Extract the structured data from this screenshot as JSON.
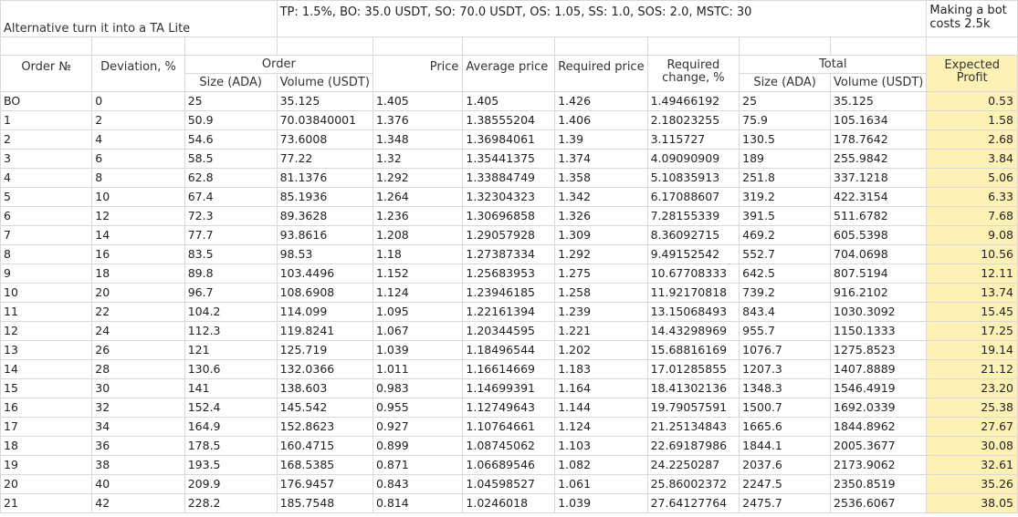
{
  "top": {
    "left_note": "Alternative turn it into a TA Lite",
    "params_note": "TP: 1.5%, BO: 35.0 USDT, SO: 70.0 USDT, OS: 1.05, SS: 1.0, SOS: 2.0, MSTC: 30",
    "bot_note": "Making a bot costs 2.5k"
  },
  "headers": {
    "order_no": "Order №",
    "deviation": "Deviation, %",
    "order": "Order",
    "price": "Price",
    "average_price": "Average price",
    "required_price": "Required price",
    "required_change": "Required change, %",
    "total": "Total",
    "expected_profit": "Expected Profit",
    "size_ada": "Size (ADA)",
    "volume_usdt": "Volume (USDT)",
    "total_size_ada": "Size (ADA)",
    "total_volume_usdt": "Volume (USDT)"
  },
  "rows": [
    [
      "BO",
      "0",
      "25",
      "35.125",
      "1.405",
      "1.405",
      "1.426",
      "1.49466192",
      "25",
      "35.125",
      "0.53"
    ],
    [
      "1",
      "2",
      "50.9",
      "70.03840001",
      "1.376",
      "1.38555204",
      "1.406",
      "2.18023255",
      "75.9",
      "105.1634",
      "1.58"
    ],
    [
      "2",
      "4",
      "54.6",
      "73.6008",
      "1.348",
      "1.36984061",
      "1.39",
      "3.115727",
      "130.5",
      "178.7642",
      "2.68"
    ],
    [
      "3",
      "6",
      "58.5",
      "77.22",
      "1.32",
      "1.35441375",
      "1.374",
      "4.09090909",
      "189",
      "255.9842",
      "3.84"
    ],
    [
      "4",
      "8",
      "62.8",
      "81.1376",
      "1.292",
      "1.33884749",
      "1.358",
      "5.10835913",
      "251.8",
      "337.1218",
      "5.06"
    ],
    [
      "5",
      "10",
      "67.4",
      "85.1936",
      "1.264",
      "1.32304323",
      "1.342",
      "6.17088607",
      "319.2",
      "422.3154",
      "6.33"
    ],
    [
      "6",
      "12",
      "72.3",
      "89.3628",
      "1.236",
      "1.30696858",
      "1.326",
      "7.28155339",
      "391.5",
      "511.6782",
      "7.68"
    ],
    [
      "7",
      "14",
      "77.7",
      "93.8616",
      "1.208",
      "1.29057928",
      "1.309",
      "8.36092715",
      "469.2",
      "605.5398",
      "9.08"
    ],
    [
      "8",
      "16",
      "83.5",
      "98.53",
      "1.18",
      "1.27387334",
      "1.292",
      "9.49152542",
      "552.7",
      "704.0698",
      "10.56"
    ],
    [
      "9",
      "18",
      "89.8",
      "103.4496",
      "1.152",
      "1.25683953",
      "1.275",
      "10.67708333",
      "642.5",
      "807.5194",
      "12.11"
    ],
    [
      "10",
      "20",
      "96.7",
      "108.6908",
      "1.124",
      "1.23946185",
      "1.258",
      "11.92170818",
      "739.2",
      "916.2102",
      "13.74"
    ],
    [
      "11",
      "22",
      "104.2",
      "114.099",
      "1.095",
      "1.22161394",
      "1.239",
      "13.15068493",
      "843.4",
      "1030.3092",
      "15.45"
    ],
    [
      "12",
      "24",
      "112.3",
      "119.8241",
      "1.067",
      "1.20344595",
      "1.221",
      "14.43298969",
      "955.7",
      "1150.1333",
      "17.25"
    ],
    [
      "13",
      "26",
      "121",
      "125.719",
      "1.039",
      "1.18496544",
      "1.202",
      "15.68816169",
      "1076.7",
      "1275.8523",
      "19.14"
    ],
    [
      "14",
      "28",
      "130.6",
      "132.0366",
      "1.011",
      "1.16614669",
      "1.183",
      "17.01285855",
      "1207.3",
      "1407.8889",
      "21.12"
    ],
    [
      "15",
      "30",
      "141",
      "138.603",
      "0.983",
      "1.14699391",
      "1.164",
      "18.41302136",
      "1348.3",
      "1546.4919",
      "23.20"
    ],
    [
      "16",
      "32",
      "152.4",
      "145.542",
      "0.955",
      "1.12749643",
      "1.144",
      "19.79057591",
      "1500.7",
      "1692.0339",
      "25.38"
    ],
    [
      "17",
      "34",
      "164.9",
      "152.8623",
      "0.927",
      "1.10764661",
      "1.124",
      "21.25134843",
      "1665.6",
      "1844.8962",
      "27.67"
    ],
    [
      "18",
      "36",
      "178.5",
      "160.4715",
      "0.899",
      "1.08745062",
      "1.103",
      "22.69187986",
      "1844.1",
      "2005.3677",
      "30.08"
    ],
    [
      "19",
      "38",
      "193.5",
      "168.5385",
      "0.871",
      "1.06689546",
      "1.082",
      "24.2250287",
      "2037.6",
      "2173.9062",
      "32.61"
    ],
    [
      "20",
      "40",
      "209.9",
      "176.9457",
      "0.843",
      "1.04598527",
      "1.061",
      "25.86002372",
      "2247.5",
      "2350.8519",
      "35.26"
    ],
    [
      "21",
      "42",
      "228.2",
      "185.7548",
      "0.814",
      "1.0246018",
      "1.039",
      "27.64127764",
      "2475.7",
      "2536.6067",
      "38.05"
    ]
  ]
}
